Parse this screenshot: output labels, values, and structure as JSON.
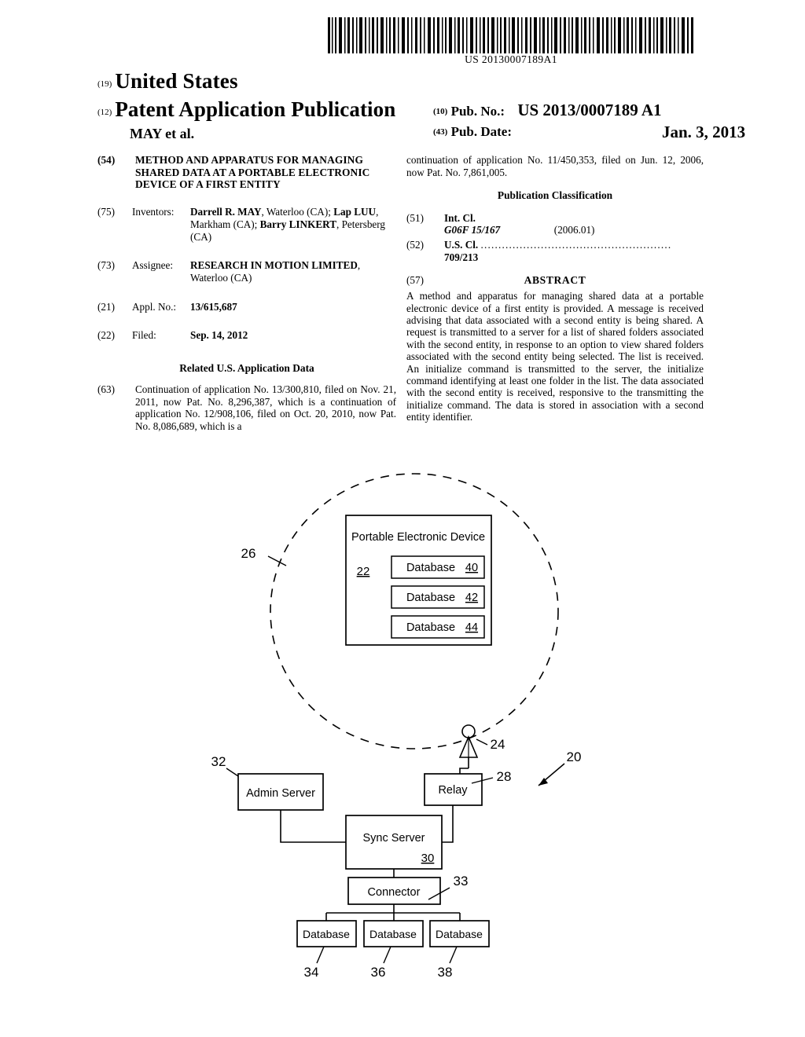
{
  "barcode": {
    "number": "US 20130007189A1",
    "icon": "barcode-icon"
  },
  "masthead": {
    "code_19": "(19)",
    "country": "United States",
    "code_12": "(12)",
    "doc_type": "Patent Application Publication",
    "author": "MAY et al.",
    "code_10": "(10)",
    "pub_no_label": "Pub. No.:",
    "pub_no_value": "US 2013/0007189 A1",
    "code_43": "(43)",
    "pub_date_label": "Pub. Date:",
    "pub_date_value": "Jan. 3, 2013"
  },
  "left_column": {
    "title": {
      "code": "(54)",
      "text": "METHOD AND APPARATUS FOR MANAGING SHARED DATA AT A PORTABLE ELECTRONIC DEVICE OF A FIRST ENTITY"
    },
    "inventors": {
      "code": "(75)",
      "label": "Inventors:",
      "names_html": "<b>Darrell R. MAY</b>, Waterloo (CA); <b>Lap LUU</b>, Markham (CA); <b>Barry LINKERT</b>, Petersberg (CA)"
    },
    "assignee": {
      "code": "(73)",
      "label": "Assignee:",
      "value_html": "<b>RESEARCH IN MOTION LIMITED</b>, Waterloo (CA)"
    },
    "appl_no": {
      "code": "(21)",
      "label": "Appl. No.:",
      "value": "13/615,687"
    },
    "filed": {
      "code": "(22)",
      "label": "Filed:",
      "value": "Sep. 14, 2012"
    },
    "related_heading": "Related U.S. Application Data",
    "continuation": {
      "code": "(63)",
      "text": "Continuation of application No. 13/300,810, filed on Nov. 21, 2011, now Pat. No. 8,296,387, which is a continuation of application No. 12/908,106, filed on Oct. 20, 2010, now Pat. No. 8,086,689, which is a"
    }
  },
  "right_column": {
    "continuation_tail": "continuation of application No. 11/450,353, filed on Jun. 12, 2006, now Pat. No. 7,861,005.",
    "publication_classification_heading": "Publication Classification",
    "int_cl": {
      "code": "(51)",
      "label": "Int. Cl.",
      "symbol": "G06F 15/167",
      "edition": "(2006.01)"
    },
    "us_cl": {
      "code": "(52)",
      "label": "U.S. Cl.",
      "dots": "......................................................",
      "value": "709/213"
    },
    "abstract": {
      "code": "(57)",
      "heading": "ABSTRACT",
      "text": "A method and apparatus for managing shared data at a portable electronic device of a first entity is provided. A message is received advising that data associated with a second entity is being shared. A request is transmitted to a server for a list of shared folders associated with the second entity, in response to an option to view shared folders associated with the second entity being selected. The list is received. An initialize command is transmitted to the server, the initialize command identifying at least one folder in the list. The data associated with the second entity is received, responsive to the transmitting the initialize command. The data is stored in association with a second entity identifier."
    }
  },
  "figure": {
    "system_ref": "20",
    "wireless_cloud_ref": "26",
    "device": {
      "title": "Portable Electronic Device",
      "ref": "22",
      "databases": [
        {
          "label": "Database",
          "ref": "40"
        },
        {
          "label": "Database",
          "ref": "42"
        },
        {
          "label": "Database",
          "ref": "44"
        }
      ]
    },
    "tower": {
      "name": "antenna-tower-icon",
      "ref": "24"
    },
    "nodes": [
      {
        "label": "Admin Server",
        "ref": "32"
      },
      {
        "label": "Relay",
        "ref": "28"
      },
      {
        "label": "Sync Server",
        "ref": "30"
      },
      {
        "label": "Connector",
        "ref": "33"
      }
    ],
    "databases": [
      {
        "label": "Database",
        "ref": "34"
      },
      {
        "label": "Database",
        "ref": "36"
      },
      {
        "label": "Database",
        "ref": "38"
      }
    ]
  }
}
